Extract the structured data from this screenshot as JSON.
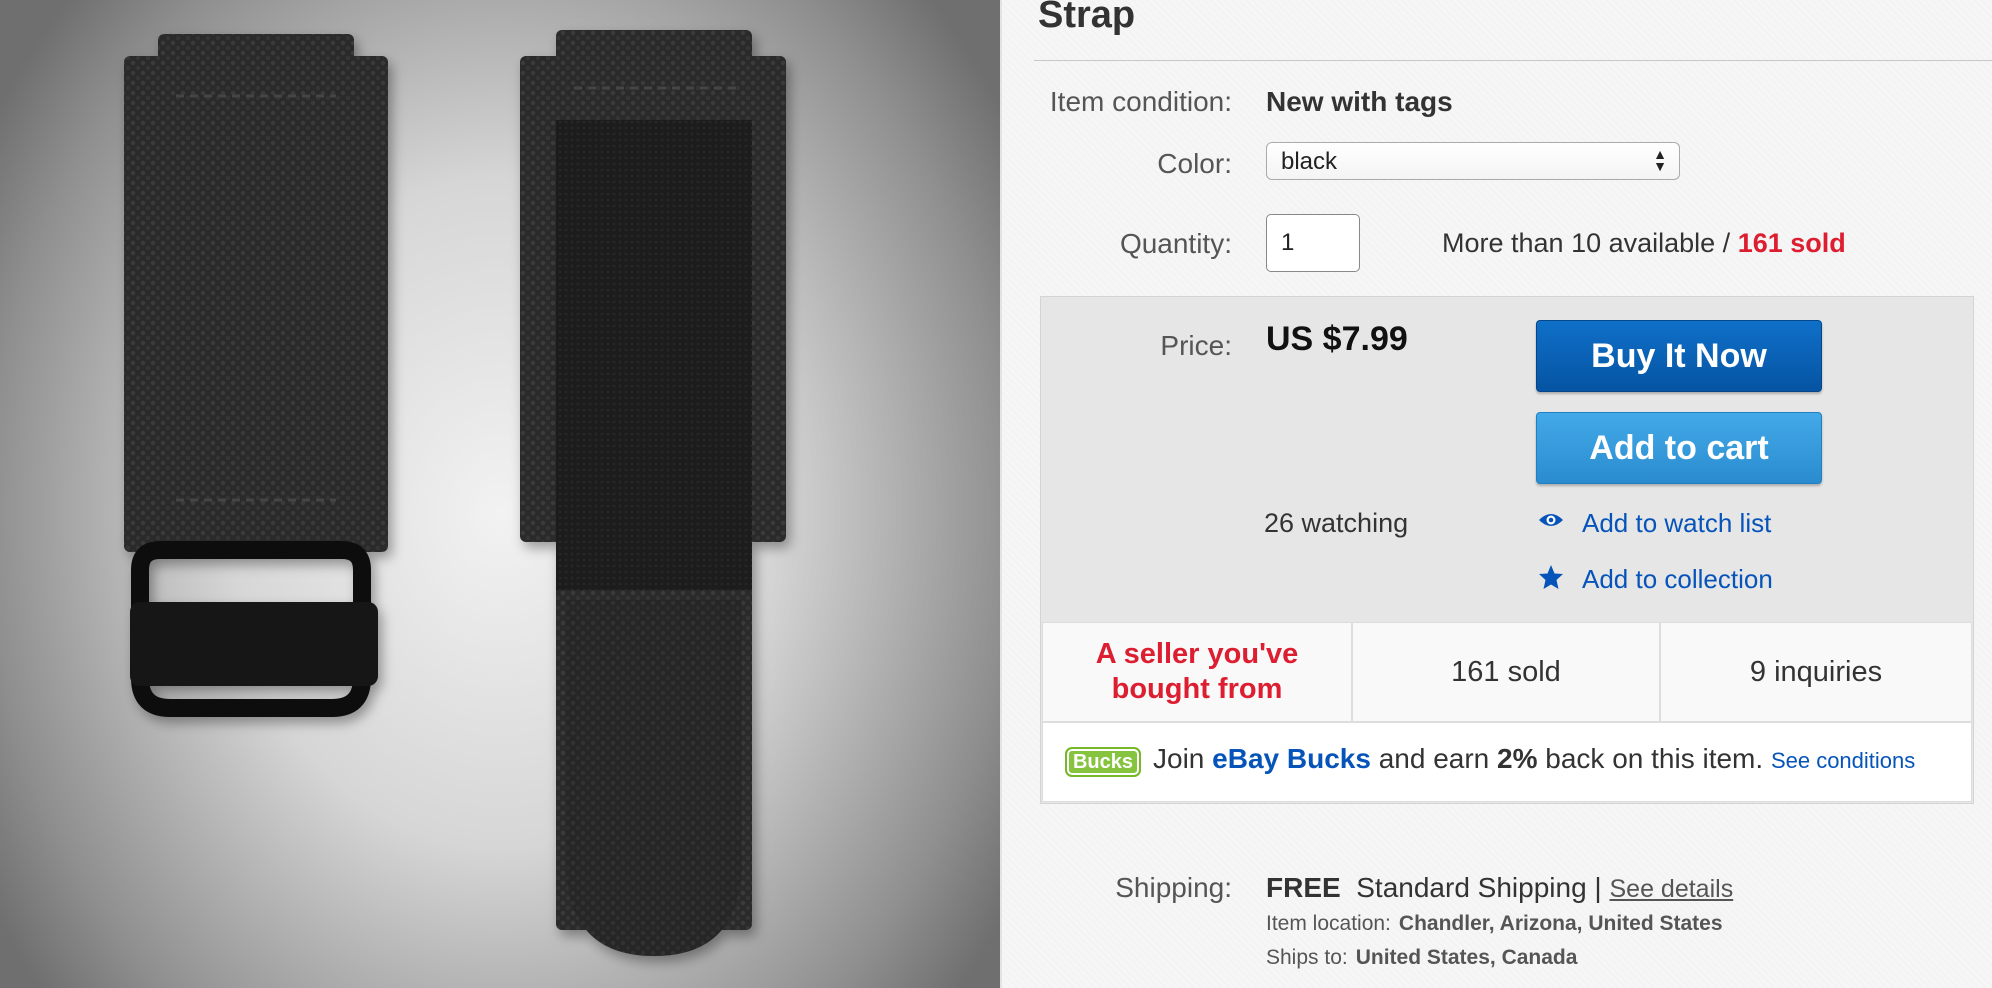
{
  "product": {
    "title": "Strap",
    "condition_label": "Item condition:",
    "condition_value": "New with tags",
    "color_label": "Color:",
    "color_value": "black",
    "quantity_label": "Quantity:",
    "quantity_value": "1",
    "availability": "More than 10 available / ",
    "sold_link": "161 sold"
  },
  "buybox": {
    "price_label": "Price:",
    "price_value": "US $7.99",
    "buy_label": "Buy It Now",
    "cart_label": "Add to cart",
    "watching": "26 watching",
    "watch_link": "Add to watch list",
    "collection_link": "Add to collection",
    "accent_color": "#0654ba"
  },
  "stats": {
    "seller_line1": "A seller you've",
    "seller_line2": "bought from",
    "sold": "161 sold",
    "inquiries": "9 inquiries"
  },
  "bucks": {
    "badge": "Bucks",
    "join": "Join ",
    "brand": "eBay Bucks",
    "earn": " and earn ",
    "pct": "2%",
    "rest": " back on this item. ",
    "conditions": "See conditions"
  },
  "shipping": {
    "label": "Shipping:",
    "free": "FREE",
    "method": "Standard Shipping",
    "sep": " | ",
    "details": "See details",
    "location_label": "Item location:",
    "location_value": "Chandler, Arizona, United States",
    "shipsto_label": "Ships to:",
    "shipsto_value": "United States, Canada"
  },
  "icons": {
    "watch": "eye-icon",
    "collection": "star-icon",
    "select_arrows": "updown-arrows-icon"
  }
}
